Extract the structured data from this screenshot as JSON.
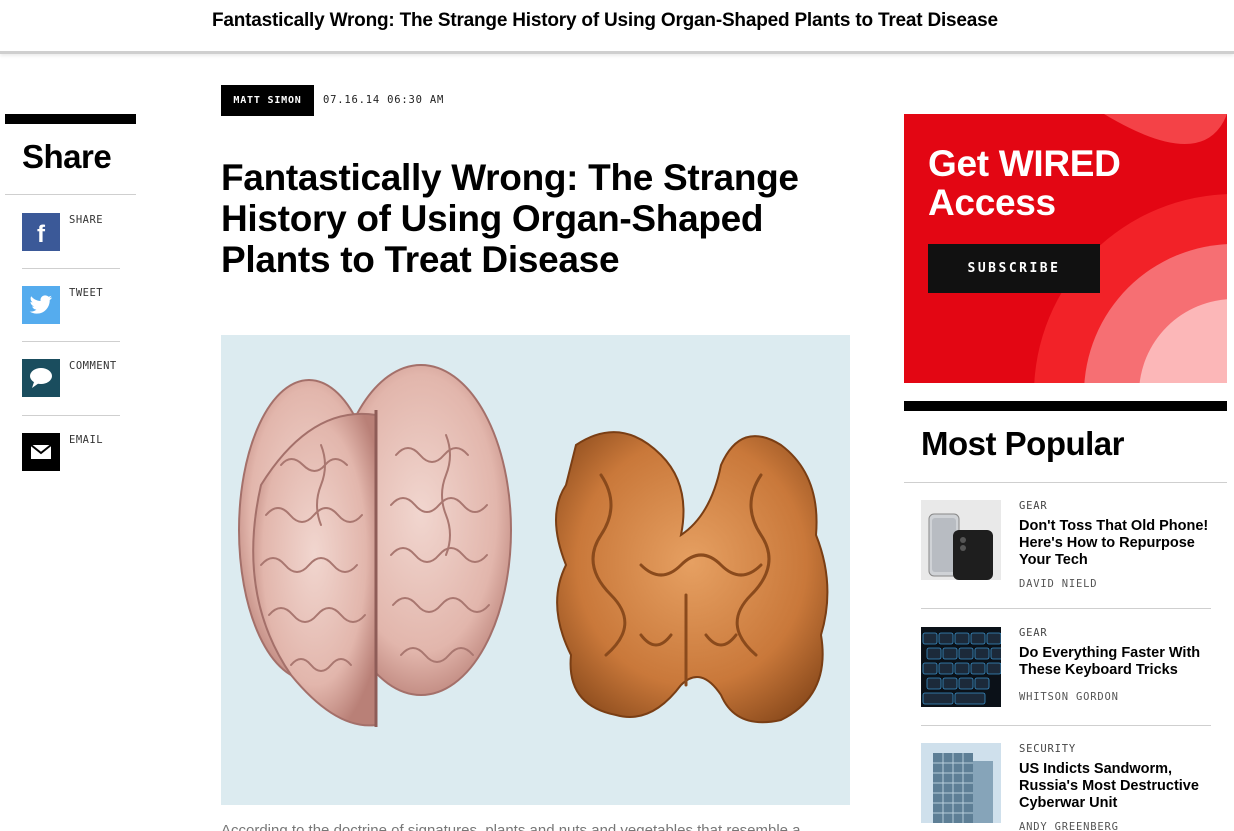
{
  "topbar": {
    "title": "Fantastically Wrong: The Strange History of Using Organ-Shaped Plants to Treat Disease"
  },
  "share": {
    "heading": "Share",
    "items": [
      {
        "label": "SHARE",
        "icon": "facebook-icon",
        "color": "#3b5998"
      },
      {
        "label": "TWEET",
        "icon": "twitter-icon",
        "color": "#55acee"
      },
      {
        "label": "COMMENT",
        "icon": "comment-icon",
        "color": "#1a4d5e"
      },
      {
        "label": "EMAIL",
        "icon": "email-icon",
        "color": "#000000"
      }
    ]
  },
  "article": {
    "author": "MATT SIMON",
    "date": "07.16.14  06:30 AM",
    "headline": "Fantastically Wrong: The Strange History of Using Organ-Shaped Plants to Treat Disease",
    "teaser": "According to the doctrine of signatures, plants and nuts and vegetables that resemble a"
  },
  "ad": {
    "title_line1": "Get WIRED",
    "title_line2": "Access",
    "button_label": "SUBSCRIBE",
    "color": "#e30613"
  },
  "most_popular": {
    "heading": "Most Popular",
    "items": [
      {
        "category": "GEAR",
        "title": "Don't Toss That Old Phone! Here's How to Repurpose Your Tech",
        "author": "DAVID NIELD",
        "thumb": "phone-thumbnail"
      },
      {
        "category": "GEAR",
        "title": "Do Everything Faster With These Keyboard Tricks",
        "author": "WHITSON GORDON",
        "thumb": "keyboard-thumbnail"
      },
      {
        "category": "SECURITY",
        "title": "US Indicts Sandworm, Russia's Most Destructive Cyberwar Unit",
        "author": "ANDY GREENBERG",
        "thumb": "building-thumbnail"
      }
    ]
  }
}
